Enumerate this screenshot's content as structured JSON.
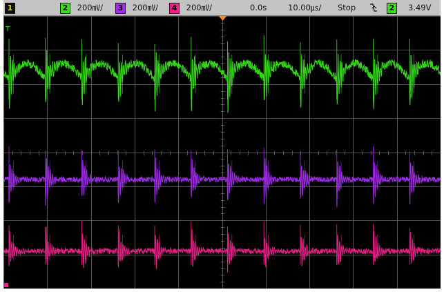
{
  "status_bar": {
    "channel_1": {
      "number": "1",
      "color": "#e8d84a"
    },
    "channel_2": {
      "number": "2",
      "scale": "200㎷/",
      "color": "#39e01c"
    },
    "channel_3": {
      "number": "3",
      "scale": "200㎷/",
      "color": "#a42cf0"
    },
    "channel_4": {
      "number": "4",
      "scale": "200㎷/",
      "color": "#f0208c"
    },
    "trigger_position": "0.0s",
    "timebase": "10.00㎲/",
    "run_state": "Stop",
    "trigger_slope_icon": "falling-edge-icon",
    "trigger_source": {
      "number": "2",
      "color": "#39e01c"
    },
    "trigger_level": "3.49V"
  },
  "screen": {
    "background": "#000000",
    "grid_color": "#6a6a6a",
    "trigger_marker_color": "#ff8a1a",
    "divisions": {
      "horizontal": 10,
      "vertical": 8
    }
  },
  "markers": {
    "trigger_level": {
      "label": "T",
      "color": "#39e01c"
    },
    "channel_4_ground": {
      "color": "#f0208c"
    }
  },
  "chart_data": {
    "type": "line",
    "description_units": "divisions",
    "x_range": [
      0,
      10
    ],
    "y_range": [
      0,
      8
    ],
    "burst_count": 12,
    "series": [
      {
        "name": "2",
        "color": "#39e01c",
        "baseline_div": 6.15,
        "swing_div": 0.45,
        "noise_div": 0.12,
        "spike_div": 1.2
      },
      {
        "name": "3",
        "color": "#a42cf0",
        "baseline_div": 3.2,
        "swing_div": 0.0,
        "noise_div": 0.08,
        "spike_div": 0.9
      },
      {
        "name": "4",
        "color": "#f0208c",
        "baseline_div": 1.1,
        "swing_div": 0.0,
        "noise_div": 0.08,
        "spike_div": 0.8
      }
    ]
  }
}
